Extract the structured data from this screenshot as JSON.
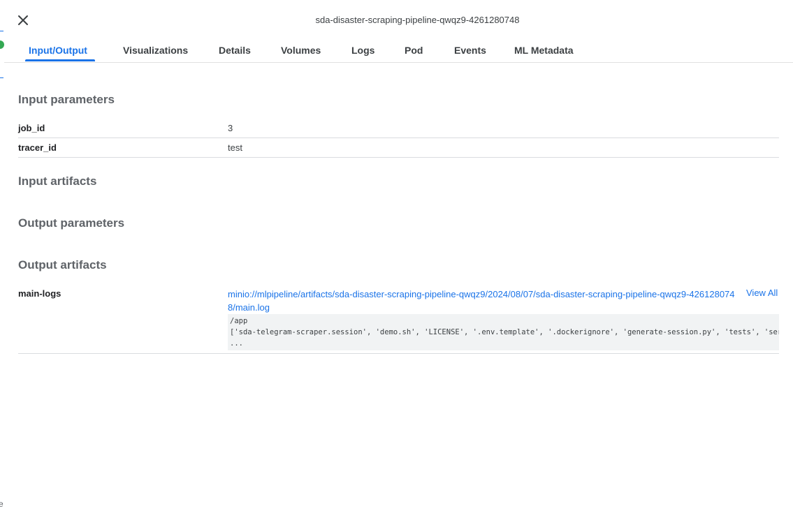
{
  "header": {
    "run_title": "sda-disaster-scraping-pipeline-qwqz9-4261280748"
  },
  "tabs": [
    {
      "label": "Input/Output",
      "active": true
    },
    {
      "label": "Visualizations",
      "active": false
    },
    {
      "label": "Details",
      "active": false
    },
    {
      "label": "Volumes",
      "active": false
    },
    {
      "label": "Logs",
      "active": false
    },
    {
      "label": "Pod",
      "active": false
    },
    {
      "label": "Events",
      "active": false
    },
    {
      "label": "ML Metadata",
      "active": false
    }
  ],
  "sections": {
    "input_parameters": {
      "title": "Input parameters",
      "rows": [
        {
          "key": "job_id",
          "value": "3"
        },
        {
          "key": "tracer_id",
          "value": "test"
        }
      ]
    },
    "input_artifacts": {
      "title": "Input artifacts"
    },
    "output_parameters": {
      "title": "Output parameters"
    },
    "output_artifacts": {
      "title": "Output artifacts",
      "rows": [
        {
          "key": "main-logs",
          "link": "minio://mlpipeline/artifacts/sda-disaster-scraping-pipeline-qwqz9/2024/08/07/sda-disaster-scraping-pipeline-qwqz9-4261280748/main.log",
          "view_all": "View All",
          "preview_lines": [
            "/app",
            "['sda-telegram-scraper.session', 'demo.sh', 'LICENSE', '.env.template', '.dockerignore', 'generate-session.py', 'tests', 'serv",
            "..."
          ]
        }
      ]
    }
  },
  "backdrop": {
    "edge_letter": "e"
  },
  "colors": {
    "accent": "#1a73e8",
    "success": "#34a853",
    "section_title": "#5f6368"
  },
  "icons": {
    "close": "close-icon"
  }
}
